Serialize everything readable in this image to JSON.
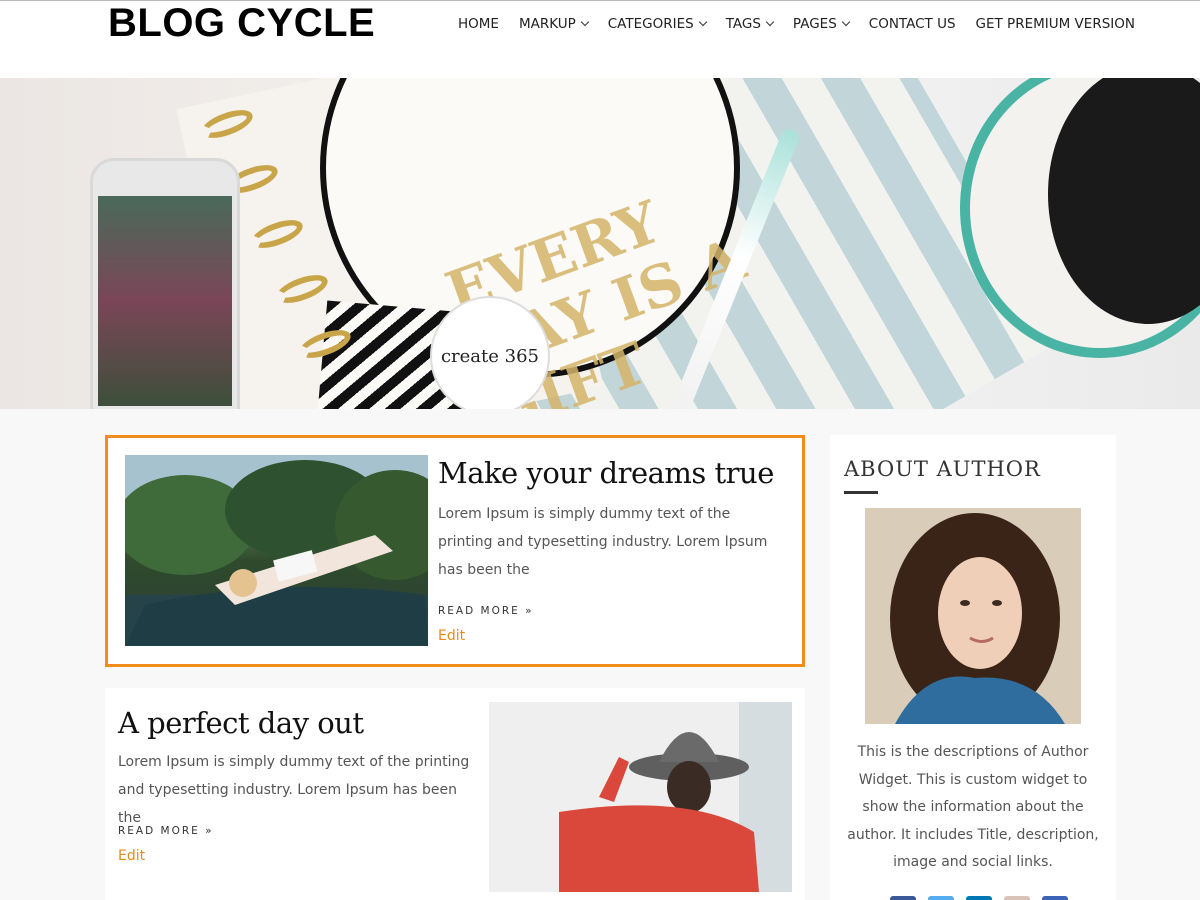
{
  "site": {
    "title": "BLOG CYCLE"
  },
  "nav": [
    {
      "label": "HOME",
      "dropdown": false
    },
    {
      "label": "MARKUP",
      "dropdown": true
    },
    {
      "label": "CATEGORIES",
      "dropdown": true
    },
    {
      "label": "TAGS",
      "dropdown": true
    },
    {
      "label": "PAGES",
      "dropdown": true
    },
    {
      "label": "CONTACT US",
      "dropdown": false
    },
    {
      "label": "GET PREMIUM VERSION",
      "dropdown": false
    }
  ],
  "hero": {
    "badge_text": "create 365",
    "gold_text": "EVERY DAY IS A GIFT"
  },
  "posts": [
    {
      "title": "Make your dreams true",
      "excerpt": "Lorem Ipsum is simply dummy text of the printing and typesetting industry. Lorem Ipsum has been the",
      "read_more": "READ MORE »",
      "edit": "Edit"
    },
    {
      "title": "A perfect day out",
      "excerpt": "Lorem Ipsum is simply dummy text of the printing and typesetting industry. Lorem Ipsum has been the",
      "read_more": "READ MORE »",
      "edit": "Edit"
    }
  ],
  "sidebar": {
    "widget_title": "ABOUT AUTHOR",
    "description": "This is the descriptions of Author Widget. This is custom widget to show the information about the author. It includes Title, description, image and social links.",
    "social_icons": [
      "facebook-icon",
      "twitter-icon",
      "linkedin-icon",
      "instagram-icon",
      "pinterest-icon"
    ]
  },
  "colors": {
    "accent": "#f08d1b",
    "edit_link": "#e88a1a",
    "social": [
      "#3b5998",
      "#55acee",
      "#0077b5",
      "#d9c2b8",
      "#3b64b8"
    ]
  }
}
